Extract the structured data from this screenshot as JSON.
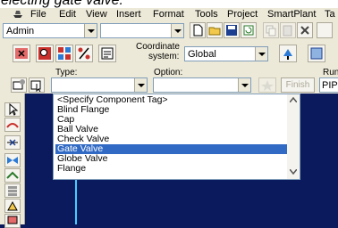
{
  "caption": "electing gate valve.",
  "menu": [
    "File",
    "Edit",
    "View",
    "Insert",
    "Format",
    "Tools",
    "Project",
    "SmartPlant",
    "Ta"
  ],
  "toolbar": {
    "user_combo": "Admin",
    "second_combo": "",
    "coordinate_label_1": "Coordinate",
    "coordinate_label_2": "system:",
    "coordinate_value": "Global"
  },
  "ribbon": {
    "type_label": "Type:",
    "option_label": "Option:",
    "run_label": "Run",
    "type_value": "",
    "option_value": "",
    "finish_label": "Finish",
    "run_value": "PIP"
  },
  "dropdown": {
    "items": [
      {
        "label": "<Specify Component Tag>",
        "selected": false
      },
      {
        "label": "Blind Flange",
        "selected": false
      },
      {
        "label": "Cap",
        "selected": false
      },
      {
        "label": "Ball Valve",
        "selected": false
      },
      {
        "label": "Check Valve",
        "selected": false
      },
      {
        "label": "Gate Valve",
        "selected": true
      },
      {
        "label": "Globe Valve",
        "selected": false
      },
      {
        "label": "Flange",
        "selected": false
      }
    ]
  },
  "colors": {
    "selection": "#316ac5",
    "canvas": "#0a1a5c",
    "panel": "#ece9d8",
    "cursor_line": "#3fd0ff"
  }
}
